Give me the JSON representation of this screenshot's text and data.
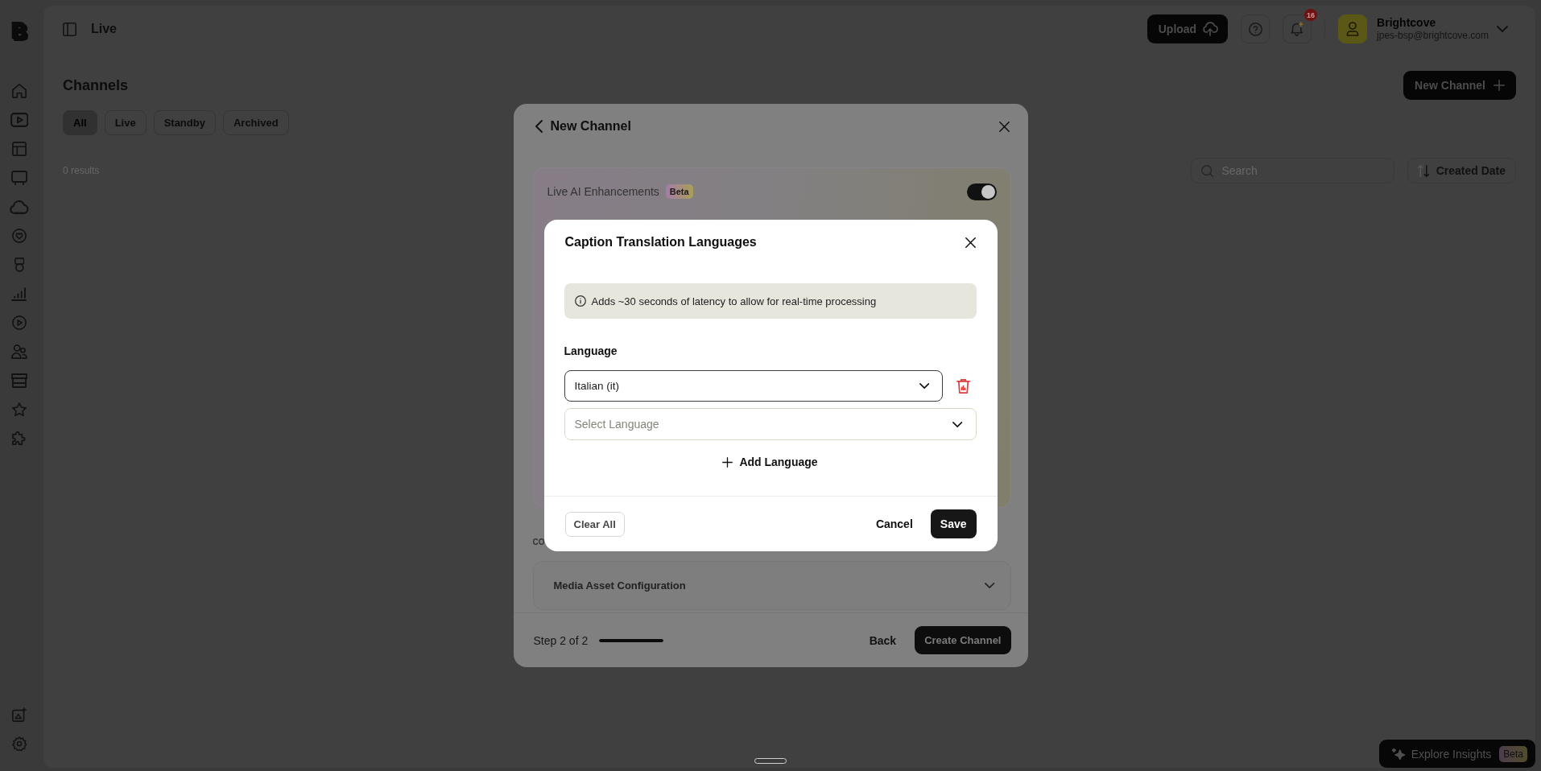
{
  "sidebar": {
    "logo": "B"
  },
  "top_bar": {
    "title": "Live",
    "upload_button": "Upload",
    "notification_badge": "16",
    "account": {
      "name": "Brightcove",
      "email": "jpes-bsp@brightcove.com"
    }
  },
  "page": {
    "title": "Channels",
    "new_button": "New Channel",
    "filters": [
      {
        "label": "All",
        "selected": true
      },
      {
        "label": "Live",
        "selected": false
      },
      {
        "label": "Standby",
        "selected": false
      },
      {
        "label": "Archived",
        "selected": false
      }
    ],
    "result_count": "0 results",
    "search": {
      "placeholder": "Search"
    },
    "sort_button": "Created Date"
  },
  "new_channel_dialog": {
    "title": "New Channel",
    "ai_card": {
      "label": "Live AI Enhancements",
      "badge": "Beta",
      "on": true
    },
    "section_label": "CO",
    "sections": [
      {
        "label": "Media Asset Configuration",
        "expanded": false
      }
    ],
    "step": "Step 2 of 2",
    "progress": {
      "level": 1
    },
    "back_button": "Back",
    "create_button": "Create Channel"
  },
  "caption_dialog": {
    "title": "Caption Translation Languages",
    "notice": "Adds ~30 seconds of latency to allow for real-time processing",
    "field_label": "Language",
    "languages": [
      {
        "value": "Italian (it)"
      },
      {
        "placeholder": "Select Language"
      }
    ],
    "add_button": "Add Language",
    "clear_button": "Clear All",
    "cancel_button": "Cancel",
    "save_button": "Save"
  },
  "insights_button": {
    "label": "Explore Insights",
    "badge": "Beta"
  }
}
